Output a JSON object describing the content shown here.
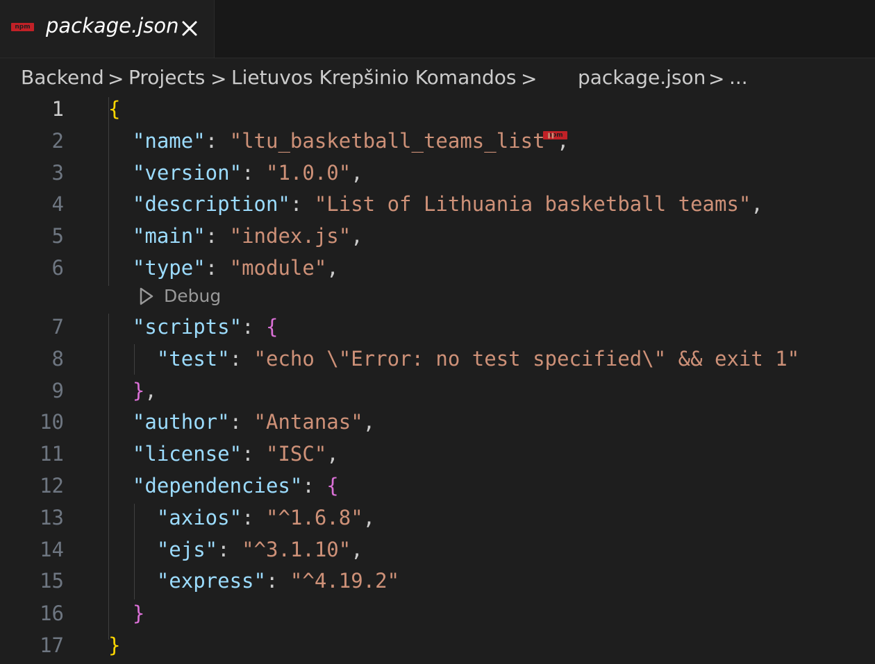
{
  "tab": {
    "badge": "npm",
    "label": "package.json",
    "close_icon": "close-icon"
  },
  "breadcrumb": {
    "items": [
      "Backend",
      "Projects",
      "Lietuvos Krepšinio Komandos",
      "package.json",
      "..."
    ],
    "badge": "npm",
    "separator": ">"
  },
  "codelens": {
    "label": "Debug",
    "icon": "play-icon"
  },
  "editor": {
    "active_line": 1,
    "lines": [
      {
        "num": "1",
        "parts": [
          {
            "t": "{",
            "c": "brace1"
          }
        ]
      },
      {
        "num": "2",
        "parts": [
          {
            "t": "  "
          },
          {
            "t": "\"name\"",
            "c": "key"
          },
          {
            "t": ": "
          },
          {
            "t": "\"ltu_basketball_teams_list\"",
            "c": "str"
          },
          {
            "t": ","
          }
        ]
      },
      {
        "num": "3",
        "parts": [
          {
            "t": "  "
          },
          {
            "t": "\"version\"",
            "c": "key"
          },
          {
            "t": ": "
          },
          {
            "t": "\"1.0.0\"",
            "c": "str"
          },
          {
            "t": ","
          }
        ]
      },
      {
        "num": "4",
        "parts": [
          {
            "t": "  "
          },
          {
            "t": "\"description\"",
            "c": "key"
          },
          {
            "t": ": "
          },
          {
            "t": "\"List of Lithuania basketball teams\"",
            "c": "str"
          },
          {
            "t": ","
          }
        ]
      },
      {
        "num": "5",
        "parts": [
          {
            "t": "  "
          },
          {
            "t": "\"main\"",
            "c": "key"
          },
          {
            "t": ": "
          },
          {
            "t": "\"index.js\"",
            "c": "str"
          },
          {
            "t": ","
          }
        ]
      },
      {
        "num": "6",
        "parts": [
          {
            "t": "  "
          },
          {
            "t": "\"type\"",
            "c": "key"
          },
          {
            "t": ": "
          },
          {
            "t": "\"module\"",
            "c": "str"
          },
          {
            "t": ","
          }
        ]
      },
      {
        "num": "7",
        "parts": [
          {
            "t": "  "
          },
          {
            "t": "\"scripts\"",
            "c": "key"
          },
          {
            "t": ": "
          },
          {
            "t": "{",
            "c": "brace2"
          }
        ]
      },
      {
        "num": "8",
        "parts": [
          {
            "t": "    "
          },
          {
            "t": "\"test\"",
            "c": "key"
          },
          {
            "t": ": "
          },
          {
            "t": "\"echo \\\"Error: no test specified\\\" && exit 1\"",
            "c": "str"
          }
        ]
      },
      {
        "num": "9",
        "parts": [
          {
            "t": "  "
          },
          {
            "t": "}",
            "c": "brace2"
          },
          {
            "t": ","
          }
        ]
      },
      {
        "num": "10",
        "parts": [
          {
            "t": "  "
          },
          {
            "t": "\"author\"",
            "c": "key"
          },
          {
            "t": ": "
          },
          {
            "t": "\"Antanas\"",
            "c": "str"
          },
          {
            "t": ","
          }
        ]
      },
      {
        "num": "11",
        "parts": [
          {
            "t": "  "
          },
          {
            "t": "\"license\"",
            "c": "key"
          },
          {
            "t": ": "
          },
          {
            "t": "\"ISC\"",
            "c": "str"
          },
          {
            "t": ","
          }
        ]
      },
      {
        "num": "12",
        "parts": [
          {
            "t": "  "
          },
          {
            "t": "\"dependencies\"",
            "c": "key"
          },
          {
            "t": ": "
          },
          {
            "t": "{",
            "c": "brace2"
          }
        ]
      },
      {
        "num": "13",
        "parts": [
          {
            "t": "    "
          },
          {
            "t": "\"axios\"",
            "c": "key"
          },
          {
            "t": ": "
          },
          {
            "t": "\"^1.6.8\"",
            "c": "str"
          },
          {
            "t": ","
          }
        ]
      },
      {
        "num": "14",
        "parts": [
          {
            "t": "    "
          },
          {
            "t": "\"ejs\"",
            "c": "key"
          },
          {
            "t": ": "
          },
          {
            "t": "\"^3.1.10\"",
            "c": "str"
          },
          {
            "t": ","
          }
        ]
      },
      {
        "num": "15",
        "parts": [
          {
            "t": "    "
          },
          {
            "t": "\"express\"",
            "c": "key"
          },
          {
            "t": ": "
          },
          {
            "t": "\"^4.19.2\"",
            "c": "str"
          }
        ]
      },
      {
        "num": "16",
        "parts": [
          {
            "t": "  "
          },
          {
            "t": "}",
            "c": "brace2"
          }
        ]
      },
      {
        "num": "17",
        "parts": [
          {
            "t": "}",
            "c": "brace1"
          }
        ]
      }
    ]
  },
  "colors": {
    "background": "#1e1e1e",
    "key": "#9cdcfe",
    "string": "#ce9178",
    "brace_level1": "#ffd700",
    "brace_level2": "#da70d6",
    "npm_badge": "#c12127"
  }
}
